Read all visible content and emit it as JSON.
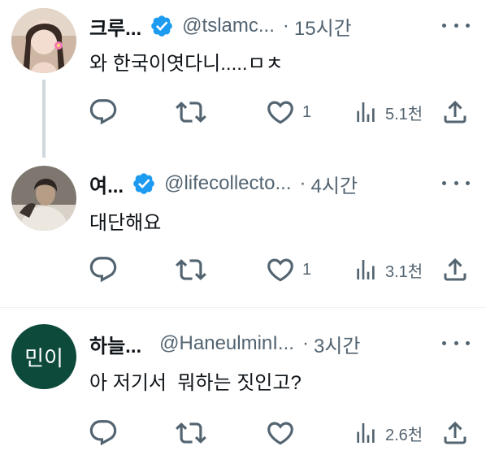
{
  "tweets": [
    {
      "author_name": "크루...",
      "verified": true,
      "handle": "@tslamc...",
      "separator": "·",
      "time": "15시간",
      "text": "와 한국이엿다니.....ㅁㅊ",
      "avatar_icon": "portrait-woman-flower-icon",
      "reply_count": "",
      "retweet_count": "",
      "like_count": "1",
      "view_count": "5.1천"
    },
    {
      "author_name": "여...",
      "verified": true,
      "handle": "@lifecollecto...",
      "separator": "·",
      "time": "4시간",
      "text": "대단해요",
      "avatar_icon": "portrait-dancer-bw-icon",
      "reply_count": "",
      "retweet_count": "",
      "like_count": "1",
      "view_count": "3.1천"
    },
    {
      "author_name": "하늘...",
      "verified": false,
      "handle": "@HaneulminI...",
      "separator": "·",
      "time": "3시간",
      "text": "아 저기서  뭐하는 짓인고?",
      "avatar_text": "민이",
      "avatar_color": "#0d4a3c",
      "reply_count": "",
      "retweet_count": "",
      "like_count": "",
      "view_count": "2.6천"
    }
  ],
  "colors": {
    "primary_text": "#0f1419",
    "secondary_text": "#536471",
    "verified_blue": "#1d9bf0",
    "thread_line": "#cfd9de",
    "divider": "#eff3f4"
  }
}
